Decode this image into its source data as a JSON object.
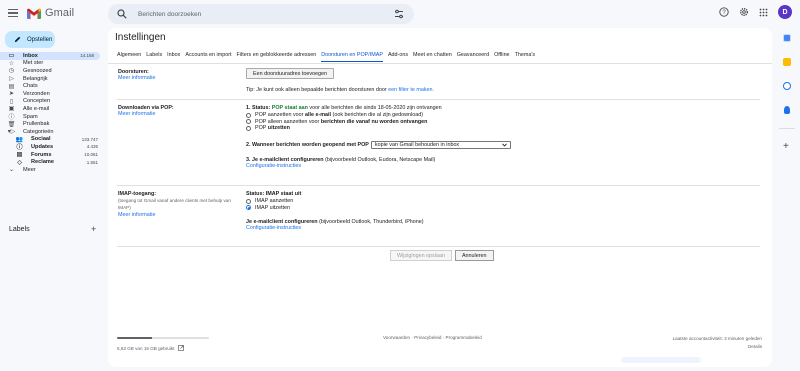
{
  "app": {
    "name": "Gmail",
    "avatar_letter": "D"
  },
  "search": {
    "placeholder": "Berichten doorzoeken"
  },
  "sidebar": {
    "compose_label": "Opstellen",
    "items": [
      {
        "label": "Inbox",
        "count": "14.168",
        "icon": "inbox-icon",
        "glyph": "▭",
        "active": true
      },
      {
        "label": "Met ster",
        "count": "",
        "icon": "star-icon",
        "glyph": "☆"
      },
      {
        "label": "Gesnoozed",
        "count": "",
        "icon": "clock-icon",
        "glyph": "◷"
      },
      {
        "label": "Belangrijk",
        "count": "",
        "icon": "important-icon",
        "glyph": "▷"
      },
      {
        "label": "Chats",
        "count": "",
        "icon": "chat-icon",
        "glyph": "▤"
      },
      {
        "label": "Verzonden",
        "count": "",
        "icon": "send-icon",
        "glyph": "➤"
      },
      {
        "label": "Concepten",
        "count": "",
        "icon": "draft-icon",
        "glyph": "▯"
      },
      {
        "label": "Alle e-mail",
        "count": "",
        "icon": "all-mail-icon",
        "glyph": "▣"
      },
      {
        "label": "Spam",
        "count": "",
        "icon": "spam-icon",
        "glyph": "ⓘ"
      },
      {
        "label": "Prullenbak",
        "count": "",
        "icon": "trash-icon",
        "glyph": "🗑"
      },
      {
        "label": "Categorieën",
        "count": "",
        "icon": "category-icon",
        "glyph": "▾▷"
      }
    ],
    "categories": [
      {
        "label": "Sociaal",
        "count": "133.747",
        "icon": "people-icon",
        "glyph": "👥"
      },
      {
        "label": "Updates",
        "count": "4.435",
        "icon": "info-icon",
        "glyph": "ⓘ"
      },
      {
        "label": "Forums",
        "count": "10.061",
        "icon": "forum-icon",
        "glyph": "▤"
      },
      {
        "label": "Reclame",
        "count": "1.551",
        "icon": "tag-icon",
        "glyph": "◇"
      }
    ],
    "more_label": "Meer",
    "labels_heading": "Labels"
  },
  "settings": {
    "title": "Instellingen",
    "tabs": [
      {
        "label": "Algemeen",
        "active": false
      },
      {
        "label": "Labels",
        "active": false
      },
      {
        "label": "Inbox",
        "active": false
      },
      {
        "label": "Accounts en import",
        "active": false
      },
      {
        "label": "Filters en geblokkeerde adressen",
        "active": false
      },
      {
        "label": "Doorsturen en POP/IMAP",
        "active": true
      },
      {
        "label": "Add-ons",
        "active": false
      },
      {
        "label": "Meet en chatten",
        "active": false
      },
      {
        "label": "Geavanceerd",
        "active": false
      },
      {
        "label": "Offline",
        "active": false
      },
      {
        "label": "Thema's",
        "active": false
      }
    ],
    "forwarding": {
      "label": "Doorsturen:",
      "more_info": "Meer informatie",
      "add_button": "Een doorstuuradres toevoegen",
      "tip_prefix": "Tip: Je kunt ook alleen bepaalde berichten doorsturen door ",
      "tip_link": "een filter te maken."
    },
    "pop": {
      "label": "Downloaden via POP:",
      "more_info": "Meer informatie",
      "status_prefix": "1. Status: ",
      "status_value": "POP staat aan",
      "status_suffix": " voor alle berichten die sinds 18-05-2020 zijn ontvangen",
      "options": [
        {
          "pre": "POP aanzetten voor ",
          "bold": "alle e-mail",
          "post": " (ook berichten die al zijn gedownload)",
          "checked": false
        },
        {
          "pre": "POP alleen aanzetten voor ",
          "bold": "berichten die vanaf nu worden ontvangen",
          "post": "",
          "checked": false
        },
        {
          "pre": "POP ",
          "bold": "uitzetten",
          "post": "",
          "checked": false
        }
      ],
      "q2_label": "2. Wanneer berichten worden geopend met POP",
      "q2_value": "kopie van Gmail behouden in inbox",
      "q3_bold": "3. Je e-mailclient configureren",
      "q3_rest": " (bijvoorbeeld Outlook, Eudora, Netscape Mail)",
      "config_link": "Configuratie-instructies"
    },
    "imap": {
      "label": "IMAP-toegang:",
      "sublabel": "(toegang tot Gmail vanaf andere clients met behulp van IMAP)",
      "more_info": "Meer informatie",
      "status": "Status: IMAP staat uit",
      "options": [
        {
          "label": "IMAP aanzetten",
          "checked": false
        },
        {
          "label": "IMAP uitzetten",
          "checked": true
        }
      ],
      "client_bold": "Je e-mailclient configureren",
      "client_rest": " (bijvoorbeeld Outlook, Thunderbird, iPhone)",
      "config_link": "Configuratie-instructies"
    },
    "save_button": "Wijzigingen opslaan",
    "cancel_button": "Annuleren"
  },
  "footer": {
    "storage_text": "5,63 GB van 15 GB gebruikt",
    "storage_fraction": 0.375,
    "links": "Voorwaarden · Privacybeleid · Programmabeleid",
    "last_activity": "Laatste accountactiviteit: 2 minuten geleden",
    "details": "Details"
  }
}
